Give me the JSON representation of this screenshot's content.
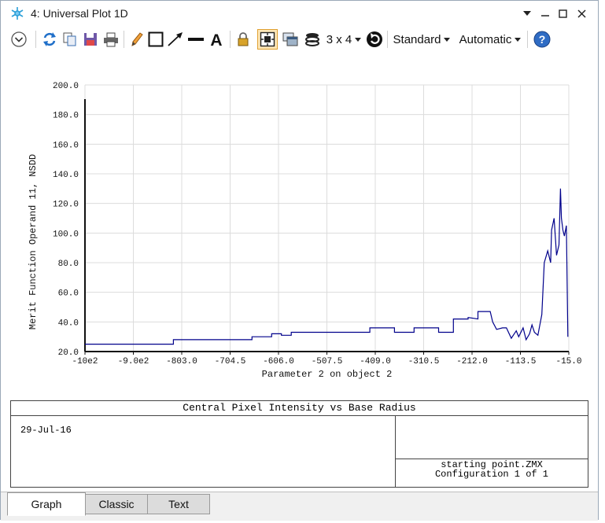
{
  "window": {
    "title": "4: Universal Plot 1D"
  },
  "toolbar": {
    "layout_label": "3 x 4",
    "style_label": "Standard",
    "scale_label": "Automatic"
  },
  "chart_data": {
    "type": "line",
    "xlabel": "Parameter 2 on object 2",
    "ylabel": "Merit Function Operand 11, NSDD",
    "x_ticks": [
      "-10e2",
      "-9.0e2",
      "-803.0",
      "-704.5",
      "-606.0",
      "-507.5",
      "-409.0",
      "-310.5",
      "-212.0",
      "-113.5",
      "-15.0"
    ],
    "y_ticks": [
      "20.0",
      "40.0",
      "60.0",
      "80.0",
      "100.0",
      "120.0",
      "140.0",
      "160.0",
      "180.0",
      "200.0"
    ],
    "xlim": [
      -1000,
      -15
    ],
    "ylim": [
      20,
      200
    ],
    "grid": true,
    "series": [
      {
        "color": "#00008b",
        "x": [
          -1000,
          -820,
          -820,
          -700,
          -700,
          -660,
          -660,
          -620,
          -620,
          -600,
          -600,
          -580,
          -580,
          -420,
          -420,
          -370,
          -370,
          -330,
          -330,
          -280,
          -280,
          -250,
          -250,
          -220,
          -220,
          -200,
          -200,
          -175,
          -170,
          -162,
          -150,
          -142,
          -132,
          -122,
          -117,
          -108,
          -102,
          -95,
          -90,
          -85,
          -78,
          -70,
          -65,
          -58,
          -52,
          -50,
          -45,
          -40,
          -35,
          -32,
          -30,
          -27,
          -24,
          -20,
          -17
        ],
        "y": [
          25,
          25,
          28,
          28,
          28,
          28,
          30,
          30,
          32,
          32,
          31,
          31,
          33,
          33,
          36,
          36,
          33,
          33,
          36,
          36,
          33,
          33,
          42,
          42,
          43,
          42,
          47,
          47,
          40,
          35,
          36,
          36,
          29,
          34,
          30,
          36,
          28,
          32,
          38,
          33,
          31,
          45,
          80,
          88,
          80,
          102,
          110,
          85,
          92,
          130,
          110,
          102,
          98,
          105,
          30
        ]
      }
    ]
  },
  "info": {
    "title": "Central Pixel Intensity vs Base Radius",
    "date": "29-Jul-16",
    "file": "starting point.ZMX",
    "config": "Configuration 1 of 1"
  },
  "tabs": [
    "Graph",
    "Classic",
    "Text"
  ]
}
